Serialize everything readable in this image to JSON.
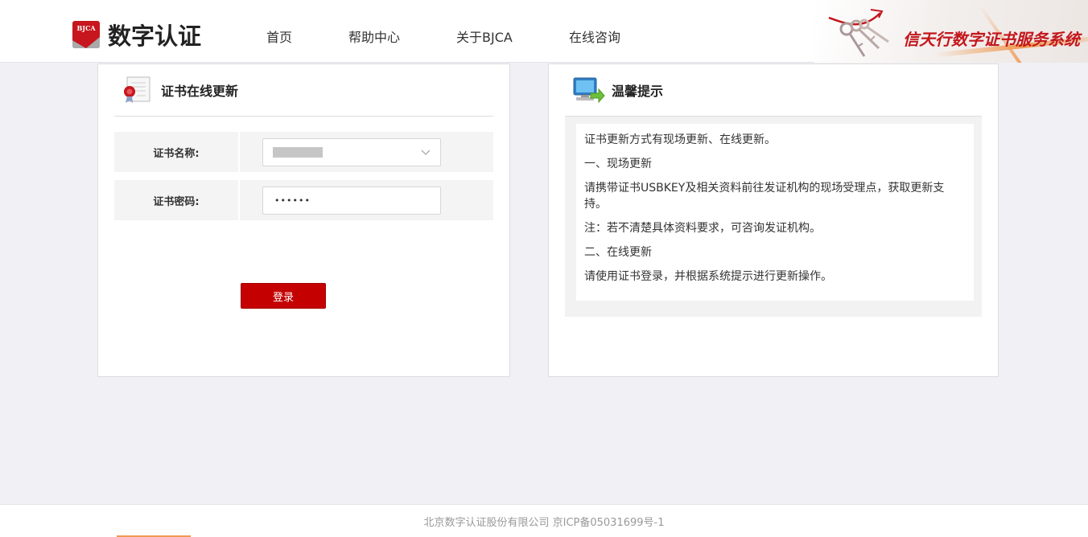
{
  "header": {
    "logo_badge": "BJCA",
    "logo_text": "数字认证",
    "nav": [
      {
        "label": "首页"
      },
      {
        "label": "帮助中心"
      },
      {
        "label": "关于BJCA"
      },
      {
        "label": "在线咨询"
      }
    ],
    "brand_slogan": "信天行数字证书服务系统"
  },
  "update_panel": {
    "title": "证书在线更新",
    "cert_name_label": "证书名称:",
    "cert_password_label": "证书密码:",
    "password_value": "••••••",
    "login_label": "登录"
  },
  "tips_panel": {
    "title": "温馨提示",
    "lines": [
      "证书更新方式有现场更新、在线更新。",
      "一、现场更新",
      "请携带证书USBKEY及相关资料前往发证机构的现场受理点，获取更新支持。",
      "注：若不清楚具体资料要求，可咨询发证机构。",
      "二、在线更新",
      "请使用证书登录，并根据系统提示进行更新操作。"
    ]
  },
  "footer": {
    "text": "北京数字认证股份有限公司 京ICP备05031699号-1"
  },
  "colors": {
    "accent_red": "#c40000",
    "brand_red": "#c3161c",
    "page_bg": "#f1f0f5"
  },
  "icons": {
    "certificate": "certificate-icon",
    "monitor": "monitor-arrow-icon",
    "chevron": "chevron-down-icon"
  }
}
